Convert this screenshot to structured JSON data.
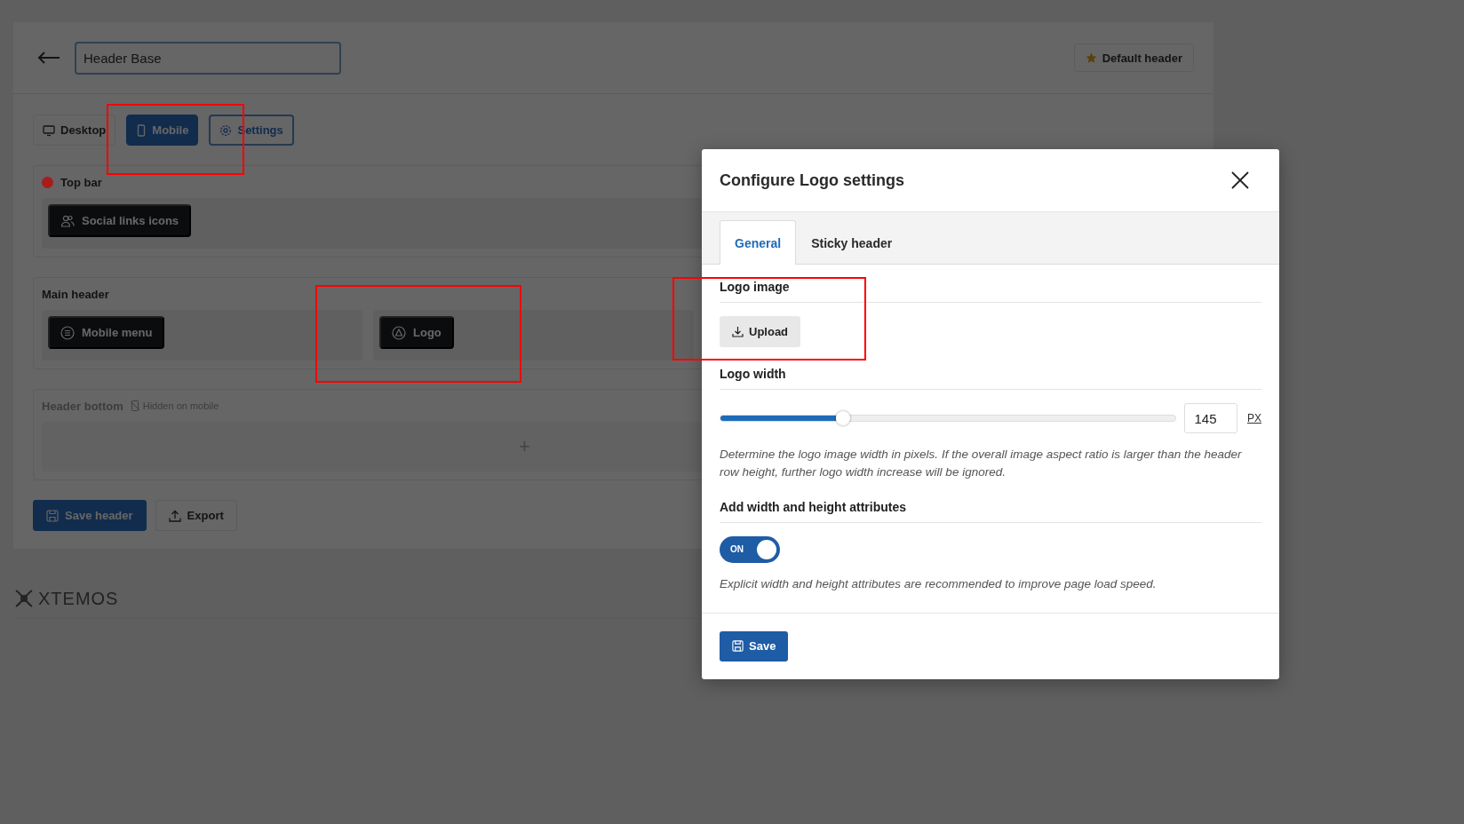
{
  "editor": {
    "name_field": {
      "value": "Header Base"
    },
    "default_button": "Default header",
    "view_tabs": [
      {
        "label": "Desktop",
        "kind": "tab",
        "selected": false
      },
      {
        "label": "Mobile",
        "kind": "tab",
        "selected": true
      },
      {
        "label": "Settings",
        "kind": "button",
        "selected": false
      }
    ],
    "rows": [
      {
        "title": "Top bar",
        "color": "#a81c1c",
        "disabled": false,
        "columns": [
          [
            {
              "label": "Social links icons",
              "kind": "social"
            }
          ]
        ]
      },
      {
        "title": "Main header",
        "disabled": false,
        "columns": [
          [
            {
              "label": "Mobile menu",
              "kind": "menu"
            }
          ],
          [
            {
              "label": "Logo",
              "kind": "logo"
            }
          ]
        ]
      },
      {
        "title": "Header bottom",
        "note": "Hidden on mobile",
        "disabled": true,
        "add_label": "+",
        "columns": []
      }
    ],
    "actions": [
      {
        "label": "Save header",
        "kind": "primary"
      },
      {
        "label": "Export",
        "kind": "secondary"
      }
    ],
    "brand": "XTEMOS"
  },
  "modal": {
    "title": "Configure Logo settings",
    "tabs": [
      {
        "label": "General",
        "selected": true
      },
      {
        "label": "Sticky header",
        "selected": false
      }
    ],
    "logo_image": {
      "label": "Logo image",
      "button": "Upload"
    },
    "logo_width": {
      "label": "Logo width",
      "level": 0.27,
      "value": "145",
      "unit": "PX",
      "description": "Determine the logo image width in pixels. If the overall image aspect ratio is larger than the header row height, further logo width increase will be ignored."
    },
    "attributes": {
      "label": "Add width and height attributes",
      "on": true,
      "toggle_label": "ON",
      "description": "Explicit width and height attributes are recommended to improve page load speed."
    },
    "save": "Save"
  }
}
